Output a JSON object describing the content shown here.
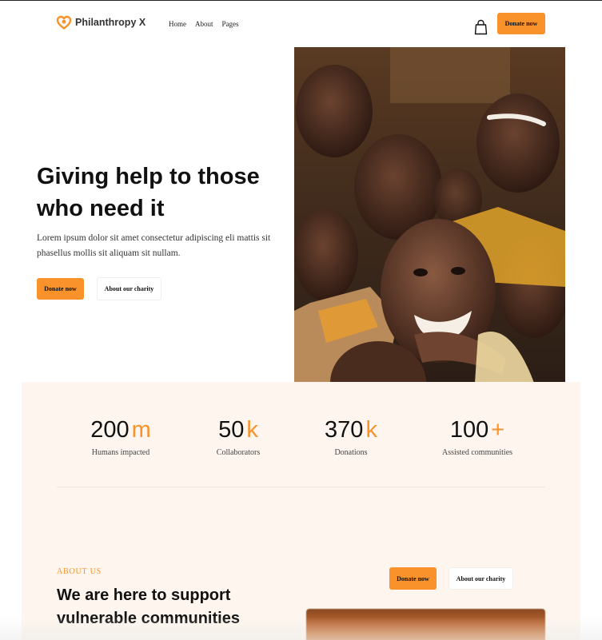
{
  "brand": {
    "name": "Philanthropy X",
    "accent_color": "#f9922a"
  },
  "nav": {
    "items": [
      "Home",
      "About",
      "Pages"
    ]
  },
  "header": {
    "cart_icon": "shopping-bag-icon",
    "donate_label": "Donate now"
  },
  "hero": {
    "title": "Giving help to those who need it",
    "text": "Lorem ipsum dolor sit amet consectetur adipiscing eli mattis sit phasellus mollis sit aliquam sit nullam.",
    "donate_label": "Donate now",
    "about_label": "About our charity"
  },
  "stats": [
    {
      "value": "200",
      "suffix": "m",
      "label": "Humans impacted"
    },
    {
      "value": "50",
      "suffix": "k",
      "label": "Collaborators"
    },
    {
      "value": "370",
      "suffix": "k",
      "label": "Donations"
    },
    {
      "value": "100",
      "suffix": "+",
      "label": "Assisted communities"
    }
  ],
  "about": {
    "eyebrow": "ABOUT US",
    "title": "We are here to support vulnerable communities",
    "donate_label": "Donate now",
    "charity_label": "About our charity"
  }
}
